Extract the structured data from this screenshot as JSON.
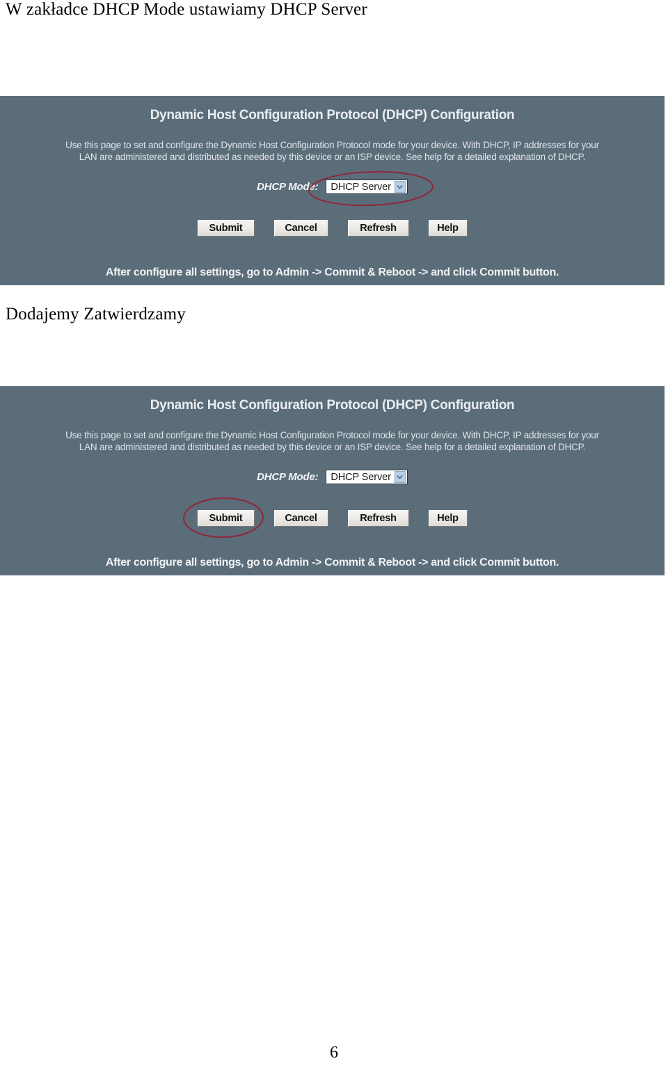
{
  "document": {
    "heading": "W zakładce DHCP Mode ustawiamy DHCP Server",
    "mid_note": "Dodajemy Zatwierdzamy",
    "page_number": "6"
  },
  "colors": {
    "panel_background": "#5c6d7a",
    "panel_text": "#e9edf0",
    "annotation_red": "#8b2b3c",
    "button_face": "#ecebe7",
    "select_arrow": "#b9cde4"
  },
  "panel": {
    "title": "Dynamic Host Configuration Protocol (DHCP) Configuration",
    "description_line1": "Use this page to set and configure the Dynamic Host Configuration Protocol mode for your device. With DHCP, IP addresses for your",
    "description_line2": "LAN are administered and distributed as needed by this device or an ISP device. See help for a detailed explanation of DHCP.",
    "mode_label": "DHCP Mode:",
    "mode_value": "DHCP Server",
    "mode_arrow_icon": "chevron-down-icon",
    "buttons": [
      {
        "label": "Submit"
      },
      {
        "label": "Cancel"
      },
      {
        "label": "Refresh"
      },
      {
        "label": "Help"
      }
    ],
    "footer_note": "After configure all settings, go to Admin -> Commit & Reboot -> and click Commit button."
  },
  "annotations": {
    "first": {
      "target": "dhcp-mode-select",
      "shape": "hand-drawn-ellipse"
    },
    "second": {
      "target": "submit-button",
      "shape": "hand-drawn-ellipse"
    }
  }
}
